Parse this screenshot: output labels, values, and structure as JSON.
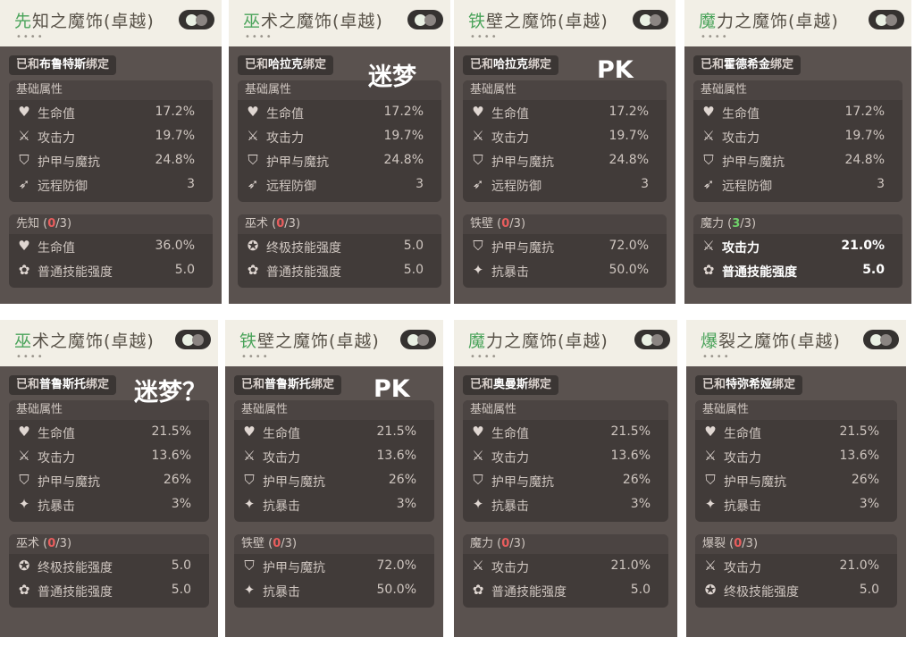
{
  "cards": [
    {
      "title_accent": "先",
      "title_rest": "知之魔饰(卓越)",
      "bound_prefix": "已和",
      "hero": "布鲁特斯",
      "bound_suffix": "绑定",
      "sections": [
        {
          "title": "基础属性",
          "rows": [
            {
              "icon": "heart-icon",
              "label": "生命值",
              "value": "17.2%"
            },
            {
              "icon": "sword-icon",
              "label": "攻击力",
              "value": "19.7%"
            },
            {
              "icon": "shield-icon",
              "label": "护甲与魔抗",
              "value": "24.8%"
            },
            {
              "icon": "ranged-defense-icon",
              "label": "远程防御",
              "value": "3"
            }
          ]
        },
        {
          "title": "先知",
          "count": "0",
          "total": "/3",
          "rows": [
            {
              "icon": "heart-icon",
              "label": "生命值",
              "value": "36.0%"
            },
            {
              "icon": "skill-icon",
              "label": "普通技能强度",
              "value": "5.0"
            }
          ]
        }
      ]
    },
    {
      "title_accent": "巫",
      "title_rest": "术之魔饰(卓越)",
      "bound_prefix": "已和",
      "hero": "哈拉克",
      "bound_suffix": "绑定",
      "sections": [
        {
          "title": "基础属性",
          "rows": [
            {
              "icon": "heart-icon",
              "label": "生命值",
              "value": "17.2%"
            },
            {
              "icon": "sword-icon",
              "label": "攻击力",
              "value": "19.7%"
            },
            {
              "icon": "shield-icon",
              "label": "护甲与魔抗",
              "value": "24.8%"
            },
            {
              "icon": "ranged-defense-icon",
              "label": "远程防御",
              "value": "3"
            }
          ]
        },
        {
          "title": "巫术",
          "count": "0",
          "total": "/3",
          "rows": [
            {
              "icon": "ultimate-icon",
              "label": "终极技能强度",
              "value": "5.0"
            },
            {
              "icon": "skill-icon",
              "label": "普通技能强度",
              "value": "5.0"
            }
          ]
        }
      ]
    },
    {
      "title_accent": "铁",
      "title_rest": "壁之魔饰(卓越)",
      "bound_prefix": "已和",
      "hero": "哈拉克",
      "bound_suffix": "绑定",
      "sections": [
        {
          "title": "基础属性",
          "rows": [
            {
              "icon": "heart-icon",
              "label": "生命值",
              "value": "17.2%"
            },
            {
              "icon": "sword-icon",
              "label": "攻击力",
              "value": "19.7%"
            },
            {
              "icon": "shield-icon",
              "label": "护甲与魔抗",
              "value": "24.8%"
            },
            {
              "icon": "ranged-defense-icon",
              "label": "远程防御",
              "value": "3"
            }
          ]
        },
        {
          "title": "铁壁",
          "count": "0",
          "total": "/3",
          "rows": [
            {
              "icon": "shield-icon",
              "label": "护甲与魔抗",
              "value": "72.0%"
            },
            {
              "icon": "crit-resist-icon",
              "label": "抗暴击",
              "value": "50.0%"
            }
          ]
        }
      ]
    },
    {
      "title_accent": "魔",
      "title_rest": "力之魔饰(卓越)",
      "bound_prefix": "已和",
      "hero": "霍德希金",
      "bound_suffix": "绑定",
      "sections": [
        {
          "title": "基础属性",
          "rows": [
            {
              "icon": "heart-icon",
              "label": "生命值",
              "value": "17.2%"
            },
            {
              "icon": "sword-icon",
              "label": "攻击力",
              "value": "19.7%"
            },
            {
              "icon": "shield-icon",
              "label": "护甲与魔抗",
              "value": "24.8%"
            },
            {
              "icon": "ranged-defense-icon",
              "label": "远程防御",
              "value": "3"
            }
          ]
        },
        {
          "title": "魔力",
          "count": "3",
          "total": "/3",
          "active": true,
          "rows": [
            {
              "icon": "sword-icon",
              "label": "攻击力",
              "value": "21.0%"
            },
            {
              "icon": "skill-icon",
              "label": "普通技能强度",
              "value": "5.0"
            }
          ]
        }
      ]
    },
    {
      "title_accent": "巫",
      "title_rest": "术之魔饰(卓越)",
      "bound_prefix": "已和",
      "hero": "普鲁斯托",
      "bound_suffix": "绑定",
      "sections": [
        {
          "title": "基础属性",
          "rows": [
            {
              "icon": "heart-icon",
              "label": "生命值",
              "value": "21.5%"
            },
            {
              "icon": "sword-icon",
              "label": "攻击力",
              "value": "13.6%"
            },
            {
              "icon": "shield-icon",
              "label": "护甲与魔抗",
              "value": "26%"
            },
            {
              "icon": "crit-resist-icon",
              "label": "抗暴击",
              "value": "3%"
            }
          ]
        },
        {
          "title": "巫术",
          "count": "0",
          "total": "/3",
          "rows": [
            {
              "icon": "ultimate-icon",
              "label": "终极技能强度",
              "value": "5.0"
            },
            {
              "icon": "skill-icon",
              "label": "普通技能强度",
              "value": "5.0"
            }
          ]
        }
      ]
    },
    {
      "title_accent": "铁",
      "title_rest": "壁之魔饰(卓越)",
      "bound_prefix": "已和",
      "hero": "普鲁斯托",
      "bound_suffix": "绑定",
      "sections": [
        {
          "title": "基础属性",
          "rows": [
            {
              "icon": "heart-icon",
              "label": "生命值",
              "value": "21.5%"
            },
            {
              "icon": "sword-icon",
              "label": "攻击力",
              "value": "13.6%"
            },
            {
              "icon": "shield-icon",
              "label": "护甲与魔抗",
              "value": "26%"
            },
            {
              "icon": "crit-resist-icon",
              "label": "抗暴击",
              "value": "3%"
            }
          ]
        },
        {
          "title": "铁壁",
          "count": "0",
          "total": "/3",
          "rows": [
            {
              "icon": "shield-icon",
              "label": "护甲与魔抗",
              "value": "72.0%"
            },
            {
              "icon": "crit-resist-icon",
              "label": "抗暴击",
              "value": "50.0%"
            }
          ]
        }
      ]
    },
    {
      "title_accent": "魔",
      "title_rest": "力之魔饰(卓越)",
      "bound_prefix": "已和",
      "hero": "奥曼斯",
      "bound_suffix": "绑定",
      "sections": [
        {
          "title": "基础属性",
          "rows": [
            {
              "icon": "heart-icon",
              "label": "生命值",
              "value": "21.5%"
            },
            {
              "icon": "sword-icon",
              "label": "攻击力",
              "value": "13.6%"
            },
            {
              "icon": "shield-icon",
              "label": "护甲与魔抗",
              "value": "26%"
            },
            {
              "icon": "crit-resist-icon",
              "label": "抗暴击",
              "value": "3%"
            }
          ]
        },
        {
          "title": "魔力",
          "count": "0",
          "total": "/3",
          "rows": [
            {
              "icon": "sword-icon",
              "label": "攻击力",
              "value": "21.0%"
            },
            {
              "icon": "skill-icon",
              "label": "普通技能强度",
              "value": "5.0"
            }
          ]
        }
      ]
    },
    {
      "title_accent": "爆",
      "title_rest": "裂之魔饰(卓越)",
      "bound_prefix": "已和",
      "hero": "特弥希娅",
      "bound_suffix": "绑定",
      "sections": [
        {
          "title": "基础属性",
          "rows": [
            {
              "icon": "heart-icon",
              "label": "生命值",
              "value": "21.5%"
            },
            {
              "icon": "sword-icon",
              "label": "攻击力",
              "value": "13.6%"
            },
            {
              "icon": "shield-icon",
              "label": "护甲与魔抗",
              "value": "26%"
            },
            {
              "icon": "crit-resist-icon",
              "label": "抗暴击",
              "value": "3%"
            }
          ]
        },
        {
          "title": "爆裂",
          "count": "0",
          "total": "/3",
          "rows": [
            {
              "icon": "sword-icon",
              "label": "攻击力",
              "value": "21.0%"
            },
            {
              "icon": "ultimate-icon",
              "label": "终极技能强度",
              "value": "5.0"
            }
          ]
        }
      ]
    }
  ],
  "annotations": [
    "迷梦",
    "PK",
    "迷梦？",
    "PK"
  ],
  "colors": {
    "accent": "#4aa35a",
    "panel": "#5a524f",
    "inactive_count": "#e85d5d",
    "active_count": "#6fd26a"
  }
}
